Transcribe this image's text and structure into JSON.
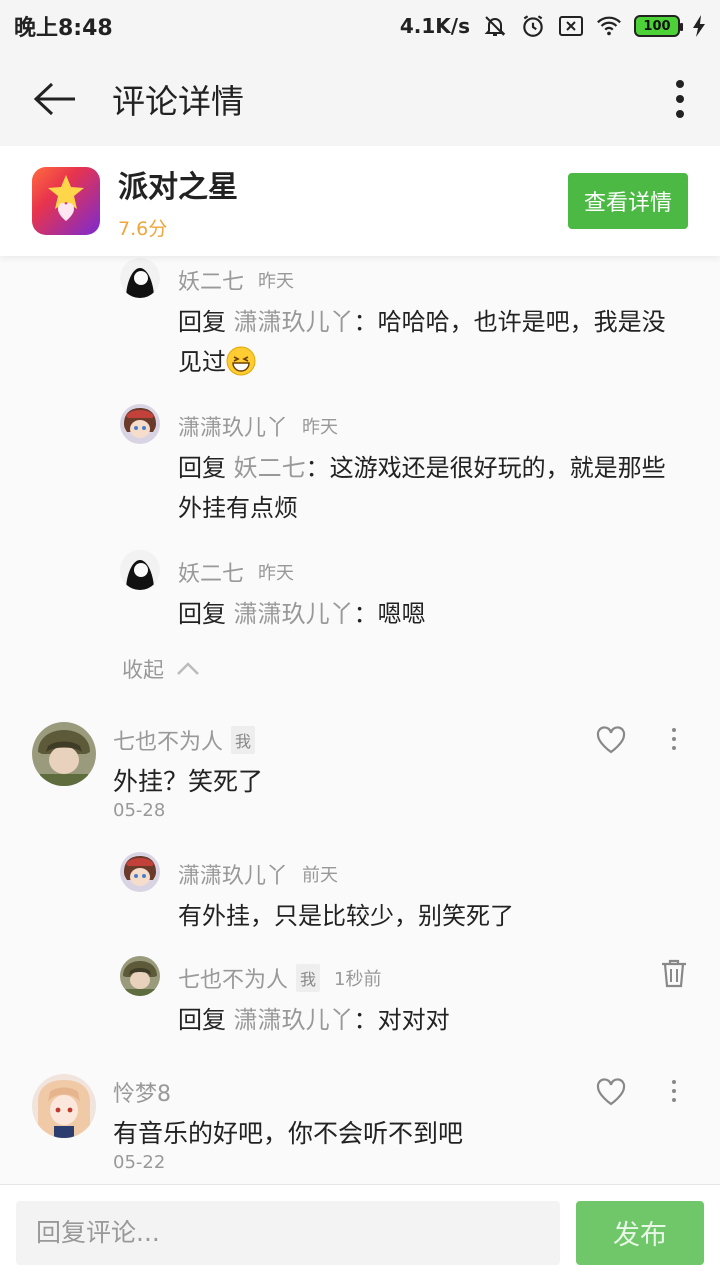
{
  "status_bar": {
    "time": "晚上8:48",
    "net_speed": "4.1K/s",
    "battery": "100"
  },
  "header": {
    "title": "评论详情"
  },
  "app": {
    "name": "派对之星",
    "score": "7.6分",
    "detail_button": "查看详情"
  },
  "thread1": {
    "replies": [
      {
        "name": "妖二七",
        "time": "昨天",
        "prefix": "回复",
        "to": "潇潇玖儿丫",
        "text": "：哈哈哈，也许是吧，我是没见过",
        "emoji": "grinning-emoji"
      },
      {
        "name": "潇潇玖儿丫",
        "time": "昨天",
        "prefix": "回复",
        "to": "妖二七",
        "text": "：这游戏还是很好玩的，就是那些外挂有点烦"
      },
      {
        "name": "妖二七",
        "time": "昨天",
        "prefix": "回复",
        "to": "潇潇玖儿丫",
        "text": "：嗯嗯"
      }
    ],
    "collapse_label": "收起"
  },
  "comment2": {
    "name": "七也不为人",
    "me_tag": "我",
    "text": "外挂？笑死了",
    "date": "05-28",
    "replies": [
      {
        "name": "潇潇玖儿丫",
        "time": "前天",
        "text": "有外挂，只是比较少，别笑死了"
      },
      {
        "name": "七也不为人",
        "me_tag": "我",
        "time": "1秒前",
        "prefix": "回复",
        "to": "潇潇玖儿丫",
        "text": "：对对对"
      }
    ]
  },
  "comment3": {
    "name": "怜梦8",
    "text": "有音乐的好吧，你不会听不到吧",
    "date": "05-22"
  },
  "bottom_bar": {
    "input_placeholder": "回复评论...",
    "publish_label": "发布"
  },
  "colors": {
    "accent_green": "#4cb944",
    "score_orange": "#f0a63a",
    "muted_text": "#999999"
  }
}
